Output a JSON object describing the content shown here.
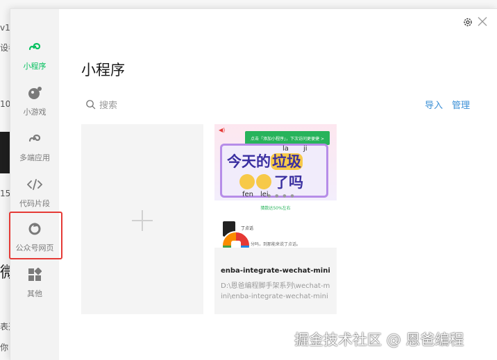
{
  "background": {
    "fragments": [
      "v1.",
      "设者",
      "10",
      "15",
      "微",
      "表开",
      "你"
    ]
  },
  "sidebar": {
    "items": [
      {
        "label": "小程序",
        "icon": "miniprogram-icon",
        "active": true
      },
      {
        "label": "小游戏",
        "icon": "minigame-icon",
        "active": false
      },
      {
        "label": "多端应用",
        "icon": "multiplatform-icon",
        "active": false
      },
      {
        "label": "代码片段",
        "icon": "code-snippet-icon",
        "active": false
      },
      {
        "label": "公众号网页",
        "icon": "official-account-web-icon",
        "active": false
      },
      {
        "label": "其他",
        "icon": "other-grid-icon",
        "active": false
      }
    ],
    "highlighted_item": "公众号网页"
  },
  "header": {
    "title": "小程序"
  },
  "search": {
    "placeholder": "搜索",
    "value": ""
  },
  "actions": {
    "import_label": "导入",
    "manage_label": "管理"
  },
  "projects": [
    {
      "name": "enba-integrate-wechat-mini",
      "path": "D:\\恩爸编程脚手架系列\\wechat-mini\\enba-integrate-wechat-mini",
      "thumbnail": {
        "tip": "点击「添加小程序」，下次访问更便捷 >",
        "pinyin_top": [
          "la",
          "ji"
        ],
        "line1_prefix": "今天的",
        "line1_highlight": "垃圾",
        "line2_text": "了吗",
        "pinyin_bottom": [
          "fen",
          "lei"
        ],
        "green_text": "猜数达50%左右",
        "app_name": "丁点话",
        "app_desc": "这里丁猜的这样分吗，到那能来说丁点话。"
      }
    }
  ],
  "watermark": "掘金技术社区 @ 恩爸编程",
  "colors": {
    "active_green": "#07c160",
    "link_blue": "#3a8fd6",
    "highlight_red": "#e53935",
    "sidebar_bg": "#f3f3f3"
  }
}
